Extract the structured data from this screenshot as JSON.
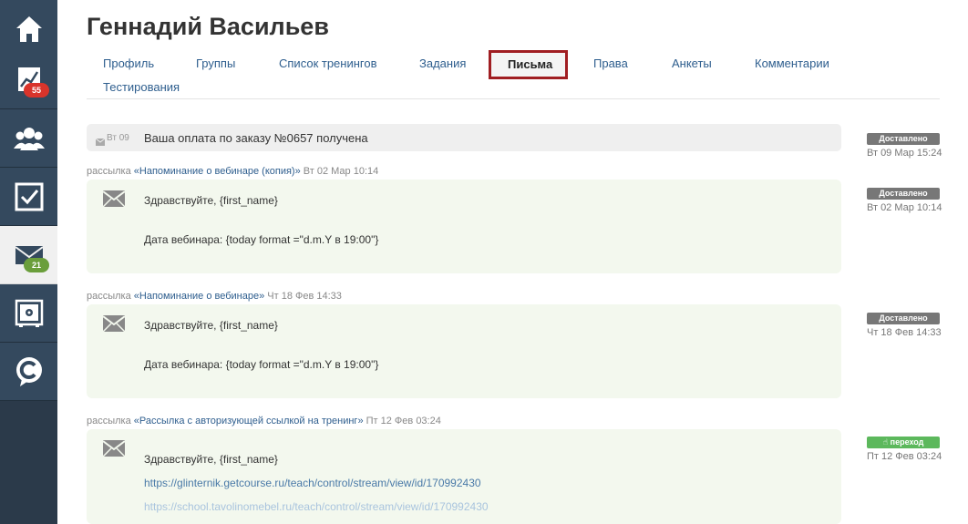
{
  "sidebar": {
    "items": [
      {
        "name": "home",
        "icon": "home-icon"
      },
      {
        "name": "stats",
        "icon": "chart-icon",
        "badge": "55"
      },
      {
        "name": "users",
        "icon": "users-icon"
      },
      {
        "name": "tasks",
        "icon": "checkbox-icon"
      },
      {
        "name": "mail",
        "icon": "envelope-icon",
        "badge": "21"
      },
      {
        "name": "safe",
        "icon": "safe-icon"
      },
      {
        "name": "chat",
        "icon": "chat-icon"
      }
    ]
  },
  "profile": {
    "name": "Геннадий Васильев"
  },
  "tabs": [
    {
      "label": "Профиль"
    },
    {
      "label": "Группы"
    },
    {
      "label": "Список тренингов"
    },
    {
      "label": "Задания"
    },
    {
      "label": "Письма"
    },
    {
      "label": "Права"
    },
    {
      "label": "Анкеты"
    },
    {
      "label": "Комментарии"
    },
    {
      "label": "Тестирования"
    }
  ],
  "messages": {
    "payment": {
      "day": "Вт 09",
      "text": "Ваша оплата по заказу №0657 получена",
      "status": "Доставлено",
      "time": "Вт 09 Мар 15:24"
    },
    "m1": {
      "prefix": "рассылка",
      "campaign": "«Напоминание о вебинаре (копия)»",
      "date": "Вт 02 Мар 10:14",
      "greeting": "Здравствуйте, {first_name}",
      "body": "Дата вебинара: {today format =\"d.m.Y в 19:00\"}",
      "status": "Доставлено",
      "time": "Вт 02 Мар 10:14"
    },
    "m2": {
      "prefix": "рассылка",
      "campaign": "«Напоминание о вебинаре»",
      "date": "Чт 18 Фев 14:33",
      "greeting": "Здравствуйте, {first_name}",
      "body": "Дата вебинара: {today format =\"d.m.Y в 19:00\"}",
      "status": "Доставлено",
      "time": "Чт 18 Фев 14:33"
    },
    "m3": {
      "prefix": "рассылка",
      "campaign": "«Рассылка с авторизующей ссылкой на тренинг»",
      "date": "Пт 12 Фев 03:24",
      "greeting": "Здравствуйте, {first_name}",
      "link1": "https://glinternik.getcourse.ru/teach/control/stream/view/id/170992430",
      "link2": "https://school.tavolinomebel.ru/teach/control/stream/view/id/170992430",
      "status": "переход",
      "time": "Пт 12 Фев 03:24"
    }
  },
  "colors": {
    "sidebar": "#34495e",
    "active_tab_border": "#a01e22",
    "link": "#2e5e8e",
    "status_delivered": "#777777",
    "status_click": "#5cb85c",
    "card_bg": "#f3f8ee"
  }
}
